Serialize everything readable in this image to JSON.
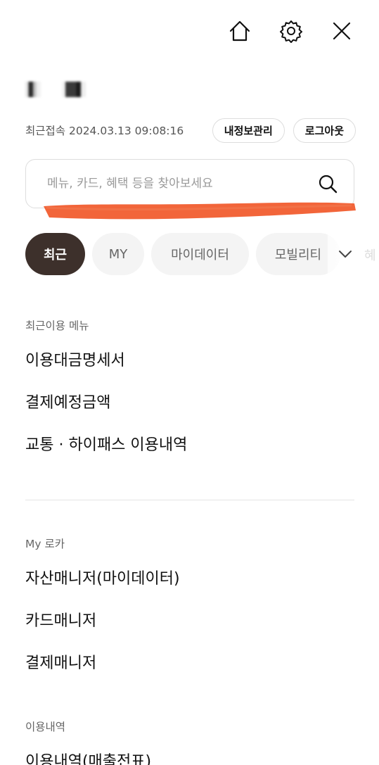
{
  "header": {
    "icons": [
      "home-icon",
      "gear-icon",
      "close-icon"
    ]
  },
  "account": {
    "last_login": "최근접속 2024.03.13 09:08:16",
    "profile_button": "내정보관리",
    "logout_button": "로그아웃"
  },
  "search": {
    "placeholder": "메뉴, 카드, 혜택 등을 찾아보세요",
    "icon": "search-icon"
  },
  "tabs": {
    "items": [
      {
        "label": "최근",
        "active": true
      },
      {
        "label": "MY",
        "active": false
      },
      {
        "label": "마이데이터",
        "active": false
      },
      {
        "label": "모빌리티",
        "active": false
      }
    ],
    "partial_label": "혜",
    "expand_icon": "chevron-down-icon"
  },
  "sections": [
    {
      "title": "최근이용 메뉴",
      "items": [
        "이용대금명세서",
        "결제예정금액",
        "교통 · 하이패스 이용내역"
      ]
    },
    {
      "title": "My 로카",
      "items": [
        "자산매니저(마이데이터)",
        "카드매니저",
        "결제매니저"
      ]
    },
    {
      "title": "이용내역",
      "items": [
        "이용내역(매출전표)"
      ]
    }
  ],
  "colors": {
    "active_tab_bg": "#3d302b",
    "chip_bg": "#f4f4f4",
    "redaction_stroke": "#f2653a"
  }
}
